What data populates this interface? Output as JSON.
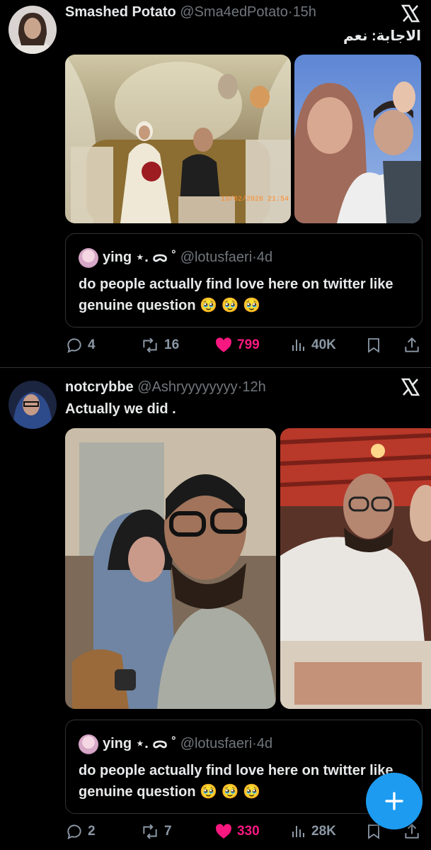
{
  "tweets": [
    {
      "name": "Smashed Potato",
      "handle": "@Sma4edPotato",
      "separator": "·",
      "time": "15h",
      "text": "الاجابة: نعم",
      "media_overlay": "13/02/2026 21:54",
      "quote": {
        "name": "ying ⋆. ᯅ ˚",
        "handle": "@lotusfaeri",
        "separator": "·",
        "time": "4d",
        "text": "do people actually find love here on twitter like genuine question",
        "emoji": "🥹 🥹 🥹"
      },
      "replies": "4",
      "reposts": "16",
      "likes": "799",
      "views": "40K"
    },
    {
      "name": "notcrybbe",
      "handle": "@Ashryyyyyyyy",
      "separator": "·",
      "time": "12h",
      "text": "Actually we did .",
      "quote": {
        "name": "ying ⋆. ᯅ ˚",
        "handle": "@lotusfaeri",
        "separator": "·",
        "time": "4d",
        "text": "do people actually find love here on twitter like genuine question",
        "emoji": "🥹 🥹 🥹"
      },
      "replies": "2",
      "reposts": "7",
      "likes": "330",
      "views": "28K"
    }
  ],
  "colors": {
    "accent": "#1d9bf0",
    "like": "#f91880",
    "muted": "#71767b"
  }
}
